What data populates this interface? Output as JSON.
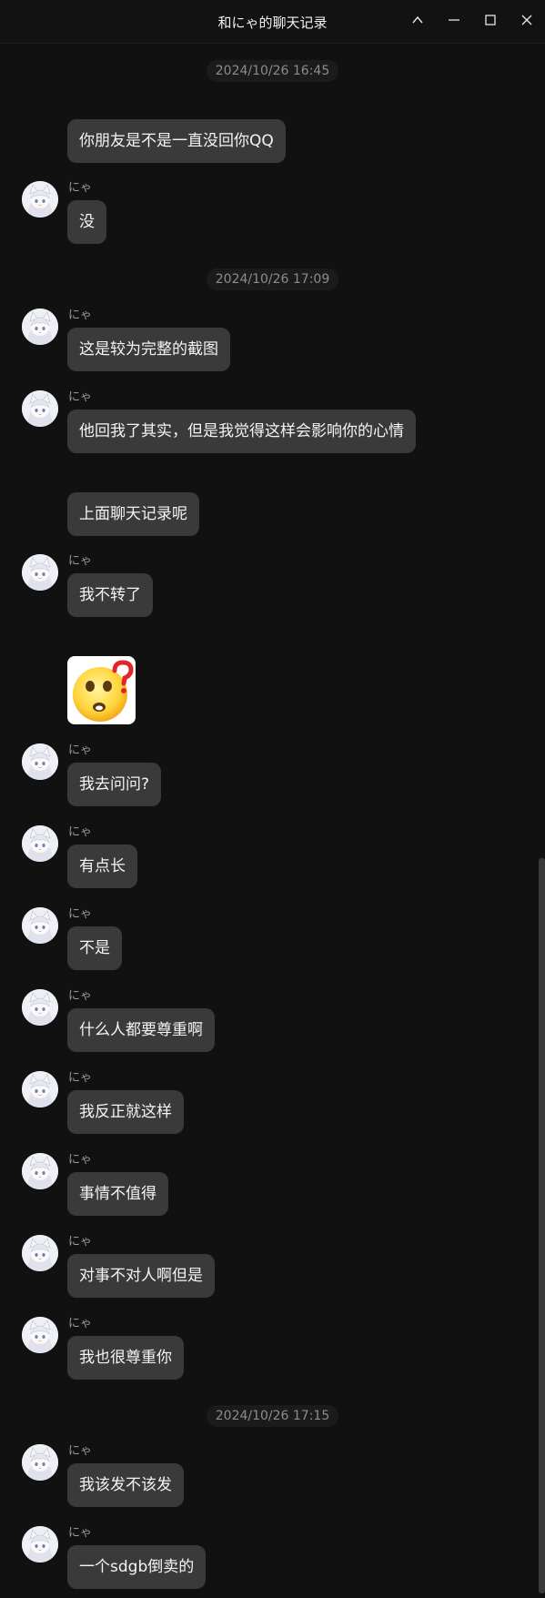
{
  "window": {
    "title": "和にゃ的聊天记录",
    "controls": [
      "chevron-up-icon",
      "minimize-icon",
      "maximize-icon",
      "close-icon"
    ]
  },
  "chat": {
    "timestamps": [
      "2024/10/26 16:45",
      "2024/10/26 17:09",
      "2024/10/26 17:15"
    ],
    "contact_name": "にゃ",
    "messages": [
      {
        "sender": "self",
        "text": "你朋友是不是一直没回你QQ"
      },
      {
        "sender": "にゃ",
        "text": "没"
      },
      {
        "sender": "にゃ",
        "text": "这是较为完整的截图"
      },
      {
        "sender": "にゃ",
        "text": "他回我了其实，但是我觉得这样会影响你的心情"
      },
      {
        "sender": "self",
        "text": "上面聊天记录呢"
      },
      {
        "sender": "にゃ",
        "text": "我不转了"
      },
      {
        "sender": "self",
        "type": "sticker",
        "sticker": "confused-face-emoji"
      },
      {
        "sender": "にゃ",
        "text": "我去问问?"
      },
      {
        "sender": "にゃ",
        "text": "有点长"
      },
      {
        "sender": "にゃ",
        "text": "不是"
      },
      {
        "sender": "にゃ",
        "text": "什么人都要尊重啊"
      },
      {
        "sender": "にゃ",
        "text": "我反正就这样"
      },
      {
        "sender": "にゃ",
        "text": "事情不值得"
      },
      {
        "sender": "にゃ",
        "text": "对事不对人啊但是"
      },
      {
        "sender": "にゃ",
        "text": "我也很尊重你"
      },
      {
        "sender": "にゃ",
        "text": "我该发不该发"
      },
      {
        "sender": "にゃ",
        "text": "一个sdgb倒卖的"
      }
    ]
  },
  "colors": {
    "background": "#111111",
    "bubble": "#3a3a3a",
    "text": "#f4f4f4",
    "muted": "#8c8c8c"
  }
}
